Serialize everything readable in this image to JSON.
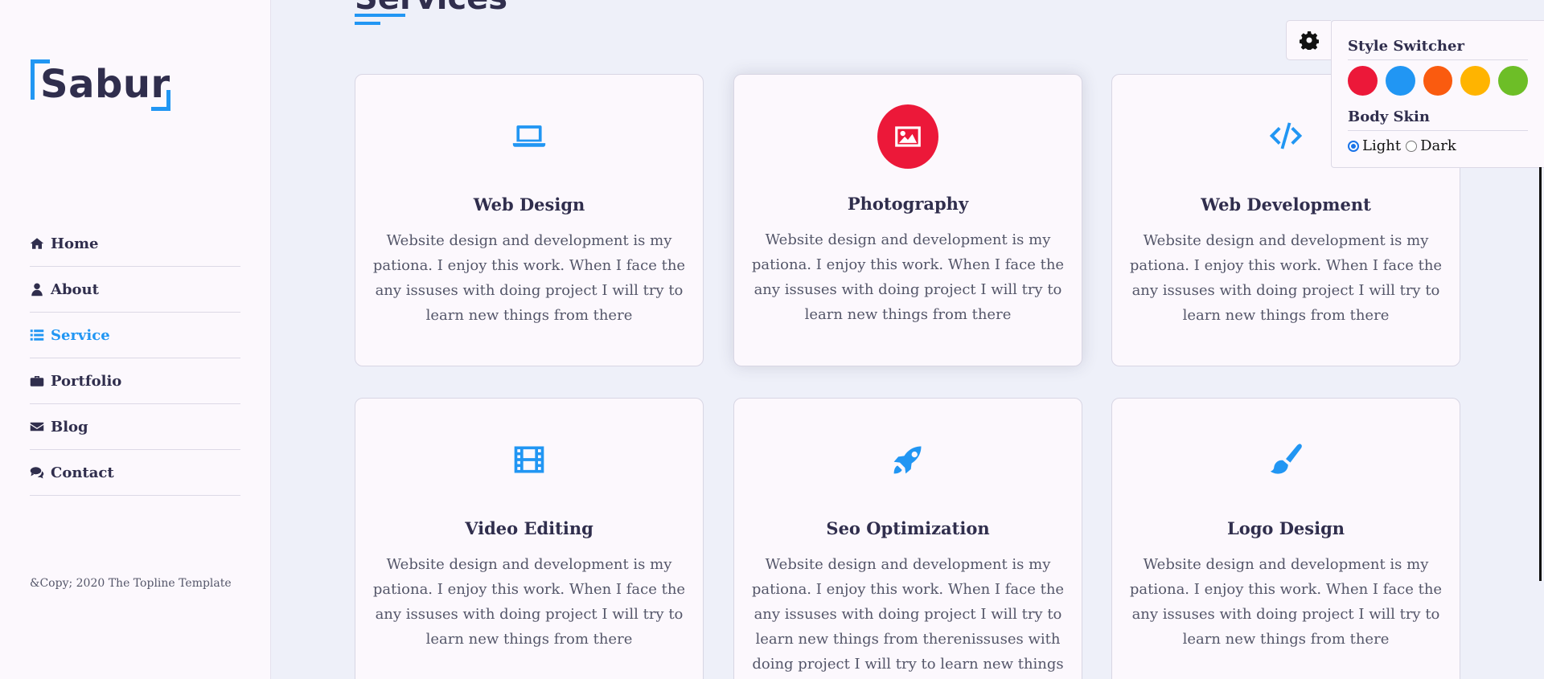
{
  "brand": {
    "name": "Sabur"
  },
  "nav": [
    {
      "label": "Home",
      "icon": "home-icon",
      "active": false
    },
    {
      "label": "About",
      "icon": "user-icon",
      "active": false
    },
    {
      "label": "Service",
      "icon": "list-icon",
      "active": true
    },
    {
      "label": "Portfolio",
      "icon": "briefcase-icon",
      "active": false
    },
    {
      "label": "Blog",
      "icon": "envelope-icon",
      "active": false
    },
    {
      "label": "Contact",
      "icon": "comments-icon",
      "active": false
    }
  ],
  "footer": {
    "copyright": "&Copy; 2020 The Topline Template"
  },
  "section": {
    "title": "Services"
  },
  "services": [
    {
      "title": "Web Design",
      "icon": "laptop-icon",
      "text": "Website design and development is my pationa. I enjoy this work. When I face the any issuses with doing project I will try to learn new things from there"
    },
    {
      "title": "Photography",
      "icon": "image-icon",
      "text": "Website design and development is my pationa. I enjoy this work. When I face the any issuses with doing project I will try to learn new things from there"
    },
    {
      "title": "Web Development",
      "icon": "code-icon",
      "text": "Website design and development is my pationa. I enjoy this work. When I face the any issuses with doing project I will try to learn new things from there"
    },
    {
      "title": "Video Editing",
      "icon": "film-icon",
      "text": "Website design and development is my pationa. I enjoy this work. When I face the any issuses with doing project I will try to learn new things from there"
    },
    {
      "title": "Seo Optimization",
      "icon": "rocket-icon",
      "text": "Website design and development is my pationa. I enjoy this work. When I face the any issuses with doing project I will try to learn new things from therenissuses with doing project I will try to learn new things from there"
    },
    {
      "title": "Logo Design",
      "icon": "paint-brush-icon",
      "text": "Website design and development is my pationa. I enjoy this work. When I face the any issuses with doing project I will try to learn new things from there"
    }
  ],
  "style_switcher": {
    "toggle_icon": "gear-icon",
    "title": "Style Switcher",
    "colors": [
      "#ec1839",
      "#2196f3",
      "#fa5b0f",
      "#ffb400",
      "#6dbe27"
    ],
    "body_skin_label": "Body Skin",
    "skins": [
      {
        "label": "Light",
        "checked": true
      },
      {
        "label": "Dark",
        "checked": false
      }
    ]
  },
  "theme": {
    "accent": "#2196f3",
    "text": "#302e4d",
    "hover_accent": "#ec1839"
  }
}
